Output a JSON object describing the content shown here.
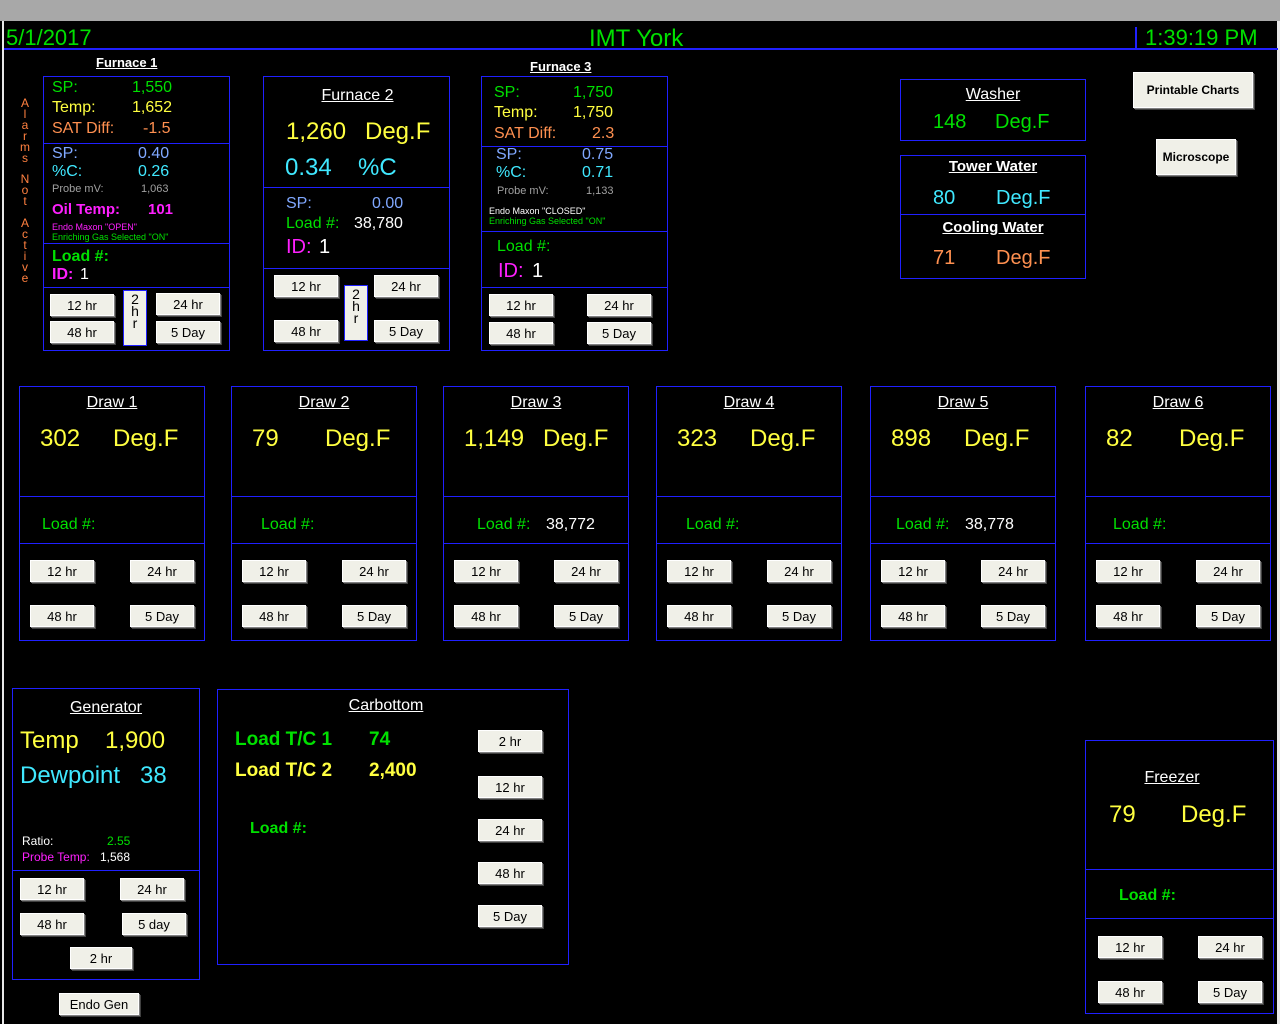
{
  "header": {
    "date": "5/1/2017",
    "site": "IMT York",
    "time": "1:39:19 PM"
  },
  "alarms": {
    "text": "Alarms Not Active"
  },
  "buttons": {
    "h12": "12 hr",
    "h24": "24 hr",
    "h48": "48 hr",
    "d5": "5 Day",
    "d5_lower": "5 day",
    "h2": "2 hr",
    "h2_vertical": "2 hr",
    "printable_charts": "Printable Charts",
    "microscope": "Microscope",
    "endo_gen": "Endo Gen"
  },
  "labels": {
    "sp": "SP:",
    "temp": "Temp:",
    "sat_diff": "SAT Diff:",
    "pct_c": "%C:",
    "probe_mv": "Probe mV:",
    "oil_temp": "Oil Temp:",
    "load": "Load #:",
    "id": "ID:",
    "degf": "Deg.F",
    "pct_c_unit": "%C"
  },
  "furnace1": {
    "title": "Furnace 1",
    "temp_sp": "1,550",
    "temp": "1,652",
    "sat_diff": "-1.5",
    "carbon_sp": "0.40",
    "carbon": "0.26",
    "probe_mv": "1,063",
    "oil_temp": "101",
    "endo_maxon": "Endo Maxon \"OPEN\"",
    "enriching_gas": "Enriching Gas Selected \"ON\"",
    "load": "",
    "id": "1"
  },
  "furnace2": {
    "title": "Furnace 2",
    "temp": "1,260",
    "carbon": "0.34",
    "sp": "0.00",
    "load": "38,780",
    "id": "1"
  },
  "furnace3": {
    "title": "Furnace 3",
    "temp_sp": "1,750",
    "temp": "1,750",
    "sat_diff": "2.3",
    "carbon_sp": "0.75",
    "carbon": "0.71",
    "probe_mv": "1,133",
    "endo_maxon": "Endo Maxon \"CLOSED\"",
    "enriching_gas": "Enriching Gas Selected \"ON\"",
    "load": "",
    "id": "1"
  },
  "washer": {
    "title": "Washer",
    "temp": "148"
  },
  "tower_water": {
    "title": "Tower Water",
    "temp": "80"
  },
  "cooling_water": {
    "title": "Cooling Water",
    "temp": "71"
  },
  "draws": [
    {
      "title": "Draw 1",
      "temp": "302",
      "load": ""
    },
    {
      "title": "Draw 2",
      "temp": "79",
      "load": ""
    },
    {
      "title": "Draw 3",
      "temp": "1,149",
      "load": "38,772"
    },
    {
      "title": "Draw 4",
      "temp": "323",
      "load": ""
    },
    {
      "title": "Draw 5",
      "temp": "898",
      "load": "38,778"
    },
    {
      "title": "Draw 6",
      "temp": "82",
      "load": ""
    }
  ],
  "generator": {
    "title": "Generator",
    "temp_label": "Temp",
    "temp": "1,900",
    "dewpoint_label": "Dewpoint",
    "dewpoint": "38",
    "ratio_label": "Ratio:",
    "ratio": "2.55",
    "probe_temp_label": "Probe Temp:",
    "probe_temp": "1,568"
  },
  "carbottom": {
    "title": "Carbottom",
    "tc1_label": "Load T/C 1",
    "tc1": "74",
    "tc2_label": "Load T/C 2",
    "tc2": "2,400",
    "load": ""
  },
  "freezer": {
    "title": "Freezer",
    "temp": "79",
    "load": ""
  },
  "colors": {
    "background": "#000000",
    "border": "#2020ff",
    "green": "#00e000",
    "yellow": "#ffff40",
    "orange": "#ff9050",
    "blue": "#80a8ff",
    "cyan": "#40e8ff",
    "magenta": "#ff20ff"
  }
}
